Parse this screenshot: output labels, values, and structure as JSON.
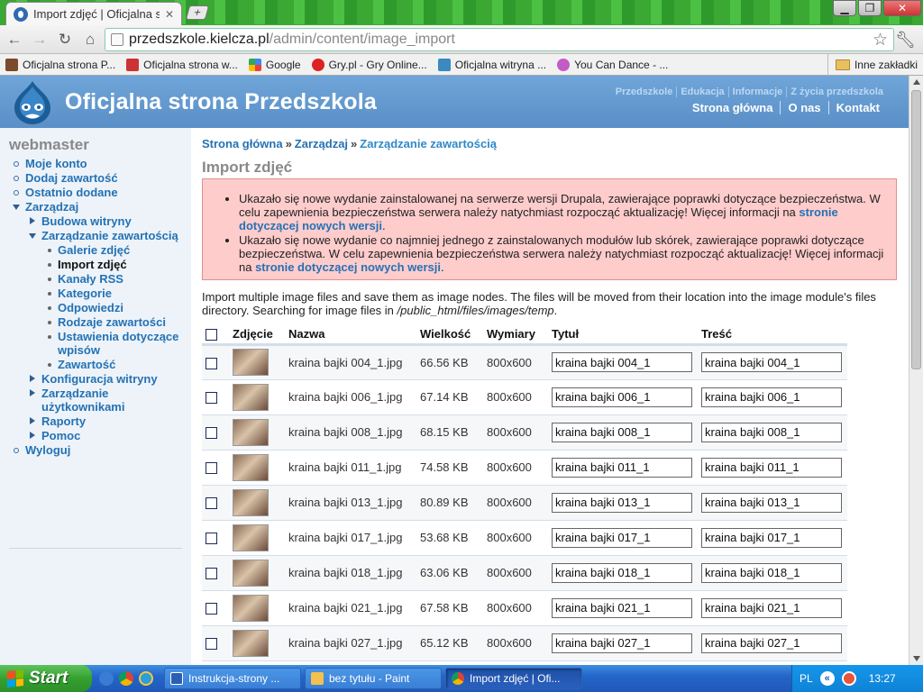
{
  "browser": {
    "tab_title": "Import zdjęć | Oficjalna s",
    "new_tab_label": "+",
    "url_domain": "przedszkole.kielcza.pl",
    "url_path": "/admin/content/image_import",
    "bookmarks": [
      {
        "label": "Oficjalna strona P...",
        "icon": "school-icon"
      },
      {
        "label": "Oficjalna strona w...",
        "icon": "crest-icon"
      },
      {
        "label": "Google",
        "icon": "google-icon"
      },
      {
        "label": "Gry.pl - Gry Online...",
        "icon": "gry-icon"
      },
      {
        "label": "Oficjalna witryna ...",
        "icon": "image-icon"
      },
      {
        "label": "You Can Dance - ...",
        "icon": "flower-icon"
      }
    ],
    "other_bookmarks": "Inne zakładki"
  },
  "site": {
    "name": "Oficjalna strona Przedszkola",
    "secondary_links": [
      "Przedszkole",
      "Edukacja",
      "Informacje",
      "Z życia przedszkola"
    ],
    "primary_links": [
      "Strona główna",
      "O nas",
      "Kontakt"
    ]
  },
  "sidebar": {
    "title": "webmaster",
    "items": [
      {
        "label": "Moje konto",
        "level": 1,
        "marker": "bullet"
      },
      {
        "label": "Dodaj zawartość",
        "level": 1,
        "marker": "bullet"
      },
      {
        "label": "Ostatnio dodane",
        "level": 1,
        "marker": "bullet"
      },
      {
        "label": "Zarządzaj",
        "level": 1,
        "marker": "expanded"
      },
      {
        "label": "Budowa witryny",
        "level": 2,
        "marker": "collapsed"
      },
      {
        "label": "Zarządzanie zawartością",
        "level": 2,
        "marker": "expanded"
      },
      {
        "label": "Galerie zdjęć",
        "level": 3,
        "marker": "dot"
      },
      {
        "label": "Import zdjęć",
        "level": 3,
        "marker": "dot",
        "active": true
      },
      {
        "label": "Kanały RSS",
        "level": 3,
        "marker": "dot"
      },
      {
        "label": "Kategorie",
        "level": 3,
        "marker": "dot"
      },
      {
        "label": "Odpowiedzi",
        "level": 3,
        "marker": "dot"
      },
      {
        "label": "Rodzaje zawartości",
        "level": 3,
        "marker": "dot"
      },
      {
        "label": "Ustawienia dotyczące wpisów",
        "level": 3,
        "marker": "dot"
      },
      {
        "label": "Zawartość",
        "level": 3,
        "marker": "dot"
      },
      {
        "label": "Konfiguracja witryny",
        "level": 2,
        "marker": "collapsed"
      },
      {
        "label": "Zarządzanie użytkownikami",
        "level": 2,
        "marker": "collapsed"
      },
      {
        "label": "Raporty",
        "level": 2,
        "marker": "collapsed"
      },
      {
        "label": "Pomoc",
        "level": 2,
        "marker": "collapsed"
      },
      {
        "label": "Wyloguj",
        "level": 1,
        "marker": "bullet"
      }
    ]
  },
  "main": {
    "breadcrumb": [
      "Strona główna",
      "Zarządzaj",
      "Zarządzanie zawartością"
    ],
    "breadcrumb_sep": "»",
    "title": "Import zdjęć",
    "messages": [
      {
        "text": "Ukazało się nowe wydanie zainstalowanej na serwerze wersji Drupala, zawierające poprawki dotyczące bezpieczeństwa. W celu zapewnienia bezpieczeństwa serwera należy natychmiast rozpocząć aktualizację! Więcej informacji na ",
        "link": "stronie dotyczącej nowych wersji",
        "tail": "."
      },
      {
        "text": "Ukazało się nowe wydanie co najmniej jednego z zainstalowanych modułów lub skórek, zawierające poprawki dotyczące bezpieczeństwa. W celu zapewnienia bezpieczeństwa serwera należy natychmiast rozpocząć aktualizację! Więcej informacji na ",
        "link": "stronie dotyczącej nowych wersji",
        "tail": "."
      }
    ],
    "intro": "Import multiple image files and save them as image nodes. The files will be moved from their location into the image module's files directory. Searching for image files in ",
    "intro_path": "/public_html/files/images/temp",
    "intro_tail": ".",
    "columns": [
      "Zdjęcie",
      "Nazwa",
      "Wielkość",
      "Wymiary",
      "Tytuł",
      "Treść"
    ],
    "rows": [
      {
        "name": "kraina bajki 004_1.jpg",
        "size": "66.56 KB",
        "dims": "800x600",
        "title": "kraina bajki 004_1",
        "body": "kraina bajki 004_1"
      },
      {
        "name": "kraina bajki 006_1.jpg",
        "size": "67.14 KB",
        "dims": "800x600",
        "title": "kraina bajki 006_1",
        "body": "kraina bajki 006_1"
      },
      {
        "name": "kraina bajki 008_1.jpg",
        "size": "68.15 KB",
        "dims": "800x600",
        "title": "kraina bajki 008_1",
        "body": "kraina bajki 008_1"
      },
      {
        "name": "kraina bajki 011_1.jpg",
        "size": "74.58 KB",
        "dims": "800x600",
        "title": "kraina bajki 011_1",
        "body": "kraina bajki 011_1"
      },
      {
        "name": "kraina bajki 013_1.jpg",
        "size": "80.89 KB",
        "dims": "800x600",
        "title": "kraina bajki 013_1",
        "body": "kraina bajki 013_1"
      },
      {
        "name": "kraina bajki 017_1.jpg",
        "size": "53.68 KB",
        "dims": "800x600",
        "title": "kraina bajki 017_1",
        "body": "kraina bajki 017_1"
      },
      {
        "name": "kraina bajki 018_1.jpg",
        "size": "63.06 KB",
        "dims": "800x600",
        "title": "kraina bajki 018_1",
        "body": "kraina bajki 018_1"
      },
      {
        "name": "kraina bajki 021_1.jpg",
        "size": "67.58 KB",
        "dims": "800x600",
        "title": "kraina bajki 021_1",
        "body": "kraina bajki 021_1"
      },
      {
        "name": "kraina bajki 027_1.jpg",
        "size": "65.12 KB",
        "dims": "800x600",
        "title": "kraina bajki 027_1",
        "body": "kraina bajki 027_1"
      }
    ]
  },
  "taskbar": {
    "start_label": "Start",
    "tasks": [
      {
        "label": "Instrukcja-strony ...",
        "icon": "word-icon"
      },
      {
        "label": "bez tytułu - Paint",
        "icon": "paint-icon"
      },
      {
        "label": "Import zdjęć | Ofi...",
        "icon": "chrome-icon",
        "active": true
      }
    ],
    "language": "PL",
    "clock": "13:27"
  },
  "colors": {
    "link": "#2472b4",
    "header_blue": "#5a8fc7",
    "error_bg": "#ffcccc",
    "chrome_green": "#2f9a2c"
  }
}
